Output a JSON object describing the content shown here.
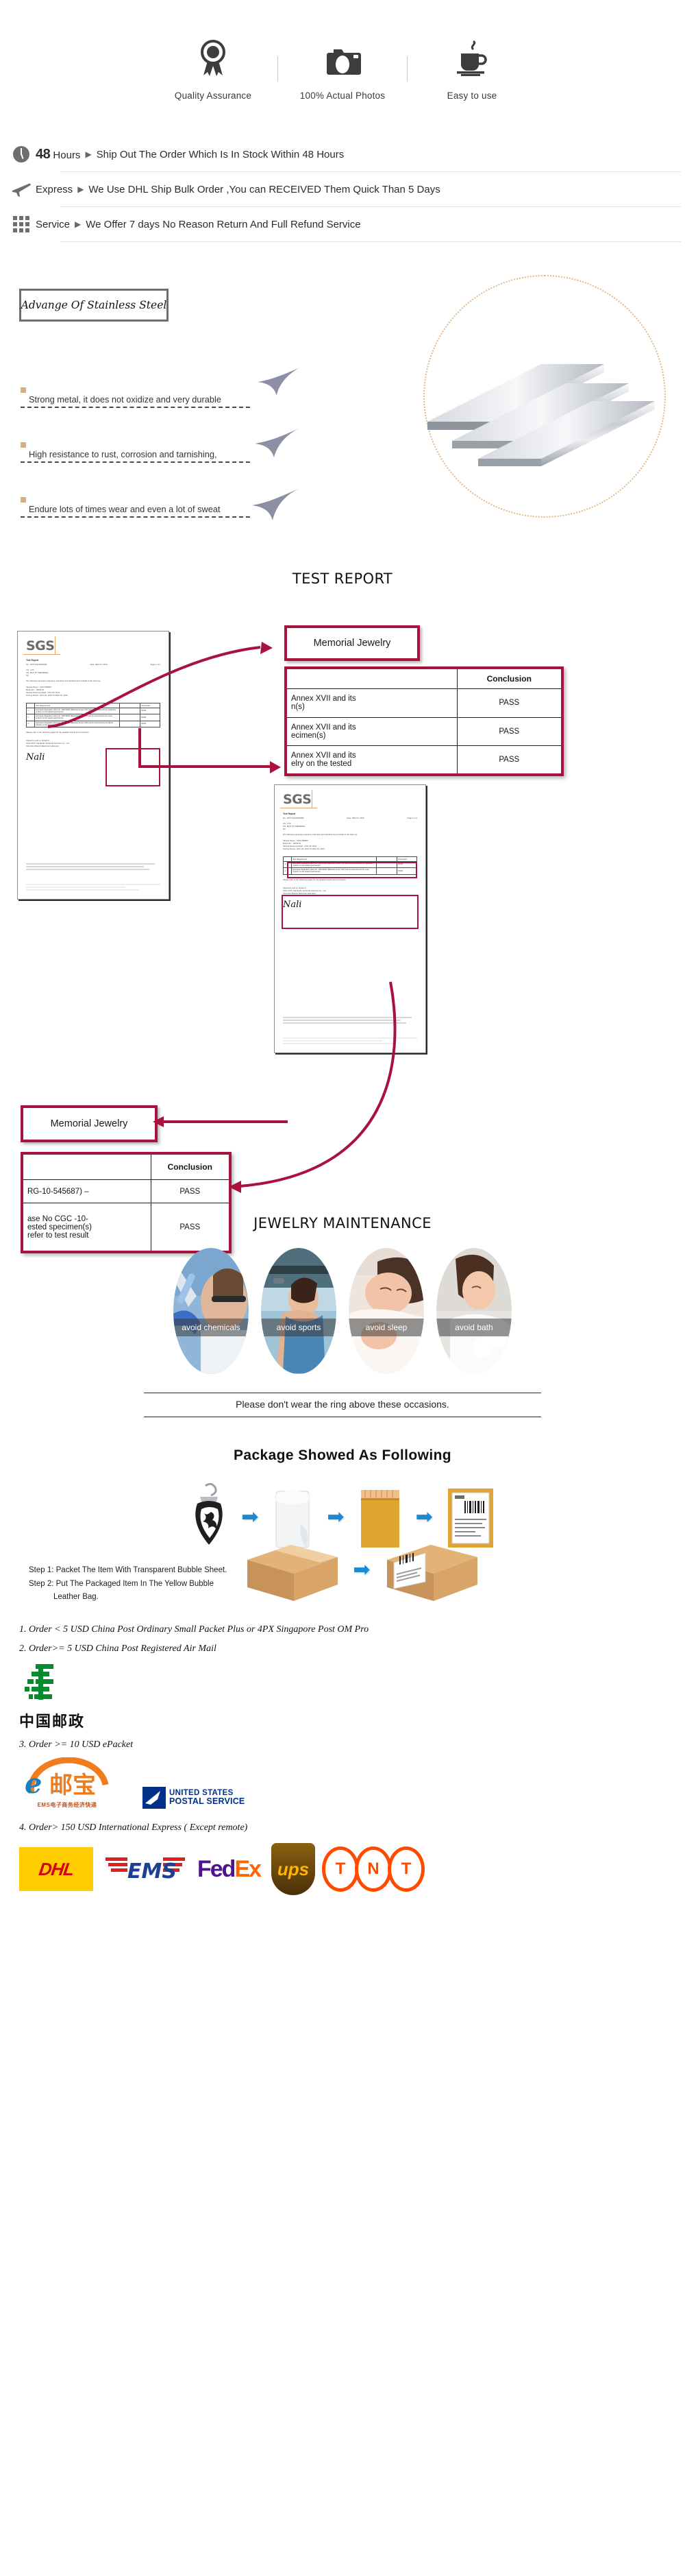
{
  "features": [
    {
      "icon": "award-ribbon-icon",
      "label": "Quality Assurance"
    },
    {
      "icon": "camera-icon",
      "label": "100% Actual Photos"
    },
    {
      "icon": "coffee-cup-icon",
      "label": "Easy to use"
    }
  ],
  "services": [
    {
      "icon": "clock-icon",
      "key_big": "48",
      "key": "Hours",
      "arrow": "▶",
      "text": "Ship Out The Order Which Is In Stock Within 48 Hours"
    },
    {
      "icon": "airplane-icon",
      "key_big": "",
      "key": "Express",
      "arrow": "▶",
      "text": "We Use DHL Ship Bulk Order ,You can RECEIVED Them Quick Than 5 Days"
    },
    {
      "icon": "grid-icon",
      "key_big": "",
      "key": "Service",
      "arrow": "▶",
      "text": "We Offer 7 days No Reason Return And Full Refund Service"
    }
  ],
  "advantage": {
    "title": "Advange Of Stainless Steel",
    "bullets": [
      "Strong metal, it does not oxidize and very durable",
      "High resistance to rust, corrosion and tarnishing,",
      "Endure lots of times wear and even a lot of sweat"
    ],
    "image_alt": "stainless-steel-bars"
  },
  "test_report": {
    "title": "TEST REPORT",
    "callout_1": "Memorial Jewelry",
    "callout_2": "Memorial Jewelry",
    "conclusion_header": "Conclusion",
    "table_top": {
      "header": "Conclusion",
      "rows": [
        {
          "desc": "Annex  XVII  and  its\nn(s)",
          "result": "PASS"
        },
        {
          "desc": "Annex  XVII  and  its\necimen(s)",
          "result": "PASS"
        },
        {
          "desc": "Annex  XVII  and  its\nelry  on  the  tested",
          "result": "PASS"
        }
      ]
    },
    "table_bottom": {
      "header": "Conclusion",
      "rows": [
        {
          "desc": "RG-10-545687) –",
          "result": "PASS"
        },
        {
          "desc": "ase No CGC -10-\nested specimen(s)\nrefer to test result",
          "result": "PASS"
        }
      ]
    },
    "cert": {
      "logo": "SGS",
      "report_label": "Test Report",
      "report_no": "No.: SZTY131100669RS",
      "report_date": "Date: DEC 04, 2013",
      "page": "Page 1 of  4",
      "company_lines": [
        "CO., LTD",
        "OG, BUJI ST SHENZHEN,",
        "NA"
      ],
      "sample_intro": "The following sample(s) was/were submitted and identified by/on behalf of the client as:",
      "fields": [
        "Sample Name :        CP13-089897",
        "Model No. :             RD36-01",
        "Sample Receiving Date :   NOV 25, 2013",
        "Testing Period :        NOV 25, 2013 TO DEC 04, 2013"
      ],
      "footer_note": "Signed for and on behalf of\nSGS-CSTC Standards Technical Services Co., Ltd.\nShenzhen Branch Electrical Laboratory",
      "conclusion_note": "Please refer to the following pages for the detailed results and conclusion.",
      "signature": "Nali",
      "test_items_header": "Test Requirement",
      "test_rows": [
        {
          "no": "1",
          "desc": "European Regulation (EC) No. 1907/2006 (REACH) Annex XVII and its amendments for Cadmium content on the tested specimen(s)",
          "result": "PASS"
        },
        {
          "no": "2",
          "desc": "European Regulation (EC) No. 1907/2006 (REACH) Annex XVII and its amendments for Lead content on the tested specimen(s)",
          "result": "PASS"
        },
        {
          "no": "3",
          "desc": "European Regulation (EC) No. 1907/2006 (REACH) Annex XVII and its amendments for Nickel release on the tested specimen(s)",
          "result": "PASS"
        }
      ],
      "col_conclusion": "Conclusion"
    }
  },
  "maintenance": {
    "title": "JEWELRY MAINTENANCE",
    "items": [
      {
        "label": "avoid chemicals",
        "img": "lab-chemicals-photo"
      },
      {
        "label": "avoid sports",
        "img": "gym-sports-photo"
      },
      {
        "label": "avoid  sleep",
        "img": "sleeping-woman-photo"
      },
      {
        "label": "avoid bath",
        "img": "bathing-woman-photo"
      }
    ],
    "note": "Please don't wear the ring above these occasions."
  },
  "package": {
    "title": "Package Showed As Following",
    "flow_top": [
      "pendant-icon",
      "bubble-sheet-icon",
      "yellow-bubble-bag-icon",
      "labeled-parcel-icon"
    ],
    "flow_bottom": [
      "carton-box-icon",
      "labeled-carton-icon"
    ],
    "arrow": "➡",
    "steps": [
      "Step 1: Packet The Item With Transparent Bubble Sheet.",
      "Step 2: Put The Packaged Item In The Yellow Bubble",
      "Leather Bag."
    ]
  },
  "shipping": {
    "lines": [
      "1. Order < 5 USD China Post Ordinary Small Packet Plus or 4PX Singapore Post OM Pro",
      "2. Order>= 5 USD  China Post Registered Air Mail",
      "3. Order >= 10 USD    ePacket",
      "4. Order> 150 USD  International Express ( Except remote)"
    ],
    "china_post_name": "中国邮政",
    "epacket_name": "邮宝",
    "epacket_sub": "EMS电子商务经济快递",
    "usps_l1": "UNITED STATES",
    "usps_l2": "POSTAL SERVICE",
    "usps_reg": "®",
    "carriers": [
      "DHL",
      "EMS",
      "FedEx",
      "ups",
      "TNT"
    ]
  },
  "colors": {
    "accent_red": "#a9123c",
    "bullet_tan": "#cfae86",
    "dotted_circle": "#e2b98a",
    "blue_arrow": "#1a8ad4",
    "post_green": "#0a8a2f"
  }
}
